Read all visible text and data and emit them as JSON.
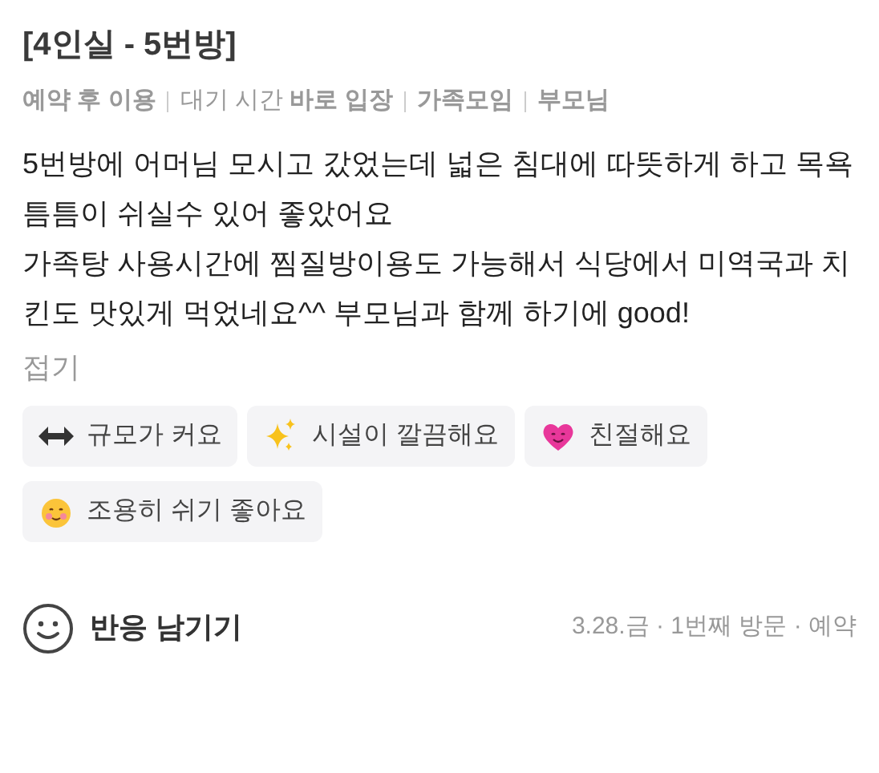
{
  "title": "[4인실 - 5번방]",
  "info": [
    "**예약 후 이용**",
    "대기 시간 **바로 입장**",
    "**가족모임**",
    "**부모님**"
  ],
  "paragraphs": [
    "5번방에 어머님 모시고 갔었는데 넓은 침대에 따뜻하게 하고 목욕 틈틈이 쉬실수 있어 좋았어요",
    "가족탕 사용시간에 찜질방이용도 가능해서 식당에서 미역국과 치킨도 맛있게 먹었네요^^ 부모님과 함께 하기에 good!"
  ],
  "collapse": "접기",
  "keywords": [
    {
      "kind": "arrows",
      "label": "규모가 커요"
    },
    {
      "kind": "sparkles",
      "label": "시설이 깔끔해요"
    },
    {
      "kind": "heart",
      "label": "친절해요"
    },
    {
      "kind": "smile",
      "label": "조용히 쉬기 좋아요"
    }
  ],
  "reaction": "반응 남기기",
  "meta": "3.28.금 · 1번째 방문 · 예약"
}
